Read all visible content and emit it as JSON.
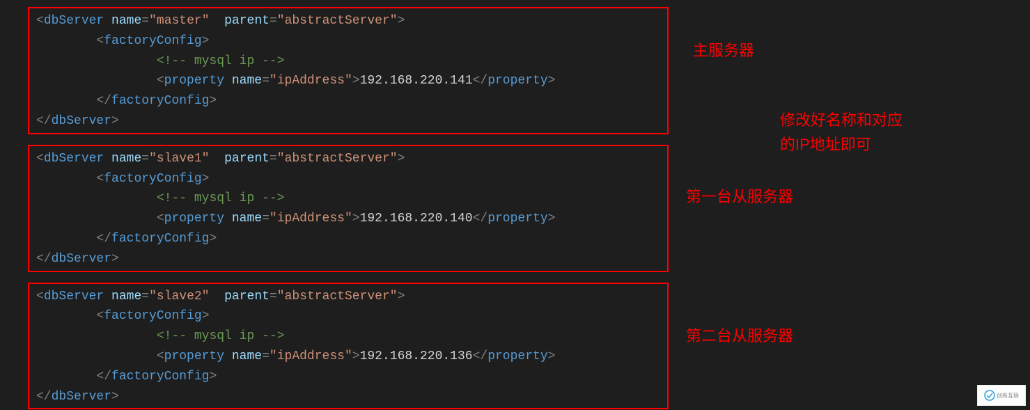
{
  "colors": {
    "bg": "#1e1e1e",
    "border": "#ff0000",
    "annotation": "#ff0000",
    "bracket": "#808080",
    "tag": "#569cd6",
    "attr_name": "#9cdcfe",
    "attr_val": "#ce9178",
    "comment": "#6a9955",
    "text": "#d4d4d4"
  },
  "annotations": {
    "master": "主服务器",
    "side_note": "修改好名称和对应的IP地址即可",
    "slave1": "第一台从服务器",
    "slave2": "第二台从服务器"
  },
  "blocks": [
    {
      "tag_open": "dbServer",
      "name_attr": "name",
      "name_val": "master",
      "parent_attr": "parent",
      "parent_val": "abstractServer",
      "factory_open": "factoryConfig",
      "comment": " mysql ip ",
      "prop_tag": "property",
      "prop_attr": "name",
      "prop_attr_val": "ipAddress",
      "ip": "192.168.220.141",
      "factory_close": "factoryConfig",
      "tag_close": "dbServer"
    },
    {
      "tag_open": "dbServer",
      "name_attr": "name",
      "name_val": "slave1",
      "parent_attr": "parent",
      "parent_val": "abstractServer",
      "factory_open": "factoryConfig",
      "comment": " mysql ip ",
      "prop_tag": "property",
      "prop_attr": "name",
      "prop_attr_val": "ipAddress",
      "ip": "192.168.220.140",
      "factory_close": "factoryConfig",
      "tag_close": "dbServer"
    },
    {
      "tag_open": "dbServer",
      "name_attr": "name",
      "name_val": "slave2",
      "parent_attr": "parent",
      "parent_val": "abstractServer",
      "factory_open": "factoryConfig",
      "comment": " mysql ip ",
      "prop_tag": "property",
      "prop_attr": "name",
      "prop_attr_val": "ipAddress",
      "ip": "192.168.220.136",
      "factory_close": "factoryConfig",
      "tag_close": "dbServer"
    }
  ],
  "watermark": "创新互联"
}
